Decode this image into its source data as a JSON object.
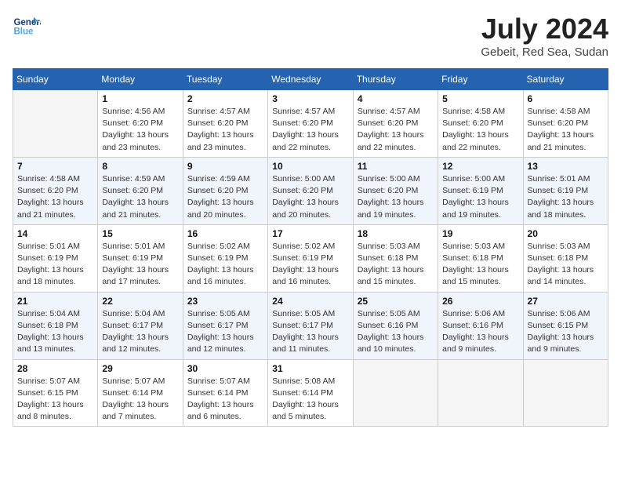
{
  "header": {
    "logo_line1": "General",
    "logo_line2": "Blue",
    "month_year": "July 2024",
    "location": "Gebeit, Red Sea, Sudan"
  },
  "days_of_week": [
    "Sunday",
    "Monday",
    "Tuesday",
    "Wednesday",
    "Thursday",
    "Friday",
    "Saturday"
  ],
  "weeks": [
    [
      {
        "day": null
      },
      {
        "day": 1,
        "sunrise": "4:56 AM",
        "sunset": "6:20 PM",
        "daylight": "13 hours and 23 minutes."
      },
      {
        "day": 2,
        "sunrise": "4:57 AM",
        "sunset": "6:20 PM",
        "daylight": "13 hours and 23 minutes."
      },
      {
        "day": 3,
        "sunrise": "4:57 AM",
        "sunset": "6:20 PM",
        "daylight": "13 hours and 22 minutes."
      },
      {
        "day": 4,
        "sunrise": "4:57 AM",
        "sunset": "6:20 PM",
        "daylight": "13 hours and 22 minutes."
      },
      {
        "day": 5,
        "sunrise": "4:58 AM",
        "sunset": "6:20 PM",
        "daylight": "13 hours and 22 minutes."
      },
      {
        "day": 6,
        "sunrise": "4:58 AM",
        "sunset": "6:20 PM",
        "daylight": "13 hours and 21 minutes."
      }
    ],
    [
      {
        "day": 7,
        "sunrise": "4:58 AM",
        "sunset": "6:20 PM",
        "daylight": "13 hours and 21 minutes."
      },
      {
        "day": 8,
        "sunrise": "4:59 AM",
        "sunset": "6:20 PM",
        "daylight": "13 hours and 21 minutes."
      },
      {
        "day": 9,
        "sunrise": "4:59 AM",
        "sunset": "6:20 PM",
        "daylight": "13 hours and 20 minutes."
      },
      {
        "day": 10,
        "sunrise": "5:00 AM",
        "sunset": "6:20 PM",
        "daylight": "13 hours and 20 minutes."
      },
      {
        "day": 11,
        "sunrise": "5:00 AM",
        "sunset": "6:20 PM",
        "daylight": "13 hours and 19 minutes."
      },
      {
        "day": 12,
        "sunrise": "5:00 AM",
        "sunset": "6:19 PM",
        "daylight": "13 hours and 19 minutes."
      },
      {
        "day": 13,
        "sunrise": "5:01 AM",
        "sunset": "6:19 PM",
        "daylight": "13 hours and 18 minutes."
      }
    ],
    [
      {
        "day": 14,
        "sunrise": "5:01 AM",
        "sunset": "6:19 PM",
        "daylight": "13 hours and 18 minutes."
      },
      {
        "day": 15,
        "sunrise": "5:01 AM",
        "sunset": "6:19 PM",
        "daylight": "13 hours and 17 minutes."
      },
      {
        "day": 16,
        "sunrise": "5:02 AM",
        "sunset": "6:19 PM",
        "daylight": "13 hours and 16 minutes."
      },
      {
        "day": 17,
        "sunrise": "5:02 AM",
        "sunset": "6:19 PM",
        "daylight": "13 hours and 16 minutes."
      },
      {
        "day": 18,
        "sunrise": "5:03 AM",
        "sunset": "6:18 PM",
        "daylight": "13 hours and 15 minutes."
      },
      {
        "day": 19,
        "sunrise": "5:03 AM",
        "sunset": "6:18 PM",
        "daylight": "13 hours and 15 minutes."
      },
      {
        "day": 20,
        "sunrise": "5:03 AM",
        "sunset": "6:18 PM",
        "daylight": "13 hours and 14 minutes."
      }
    ],
    [
      {
        "day": 21,
        "sunrise": "5:04 AM",
        "sunset": "6:18 PM",
        "daylight": "13 hours and 13 minutes."
      },
      {
        "day": 22,
        "sunrise": "5:04 AM",
        "sunset": "6:17 PM",
        "daylight": "13 hours and 12 minutes."
      },
      {
        "day": 23,
        "sunrise": "5:05 AM",
        "sunset": "6:17 PM",
        "daylight": "13 hours and 12 minutes."
      },
      {
        "day": 24,
        "sunrise": "5:05 AM",
        "sunset": "6:17 PM",
        "daylight": "13 hours and 11 minutes."
      },
      {
        "day": 25,
        "sunrise": "5:05 AM",
        "sunset": "6:16 PM",
        "daylight": "13 hours and 10 minutes."
      },
      {
        "day": 26,
        "sunrise": "5:06 AM",
        "sunset": "6:16 PM",
        "daylight": "13 hours and 9 minutes."
      },
      {
        "day": 27,
        "sunrise": "5:06 AM",
        "sunset": "6:15 PM",
        "daylight": "13 hours and 9 minutes."
      }
    ],
    [
      {
        "day": 28,
        "sunrise": "5:07 AM",
        "sunset": "6:15 PM",
        "daylight": "13 hours and 8 minutes."
      },
      {
        "day": 29,
        "sunrise": "5:07 AM",
        "sunset": "6:14 PM",
        "daylight": "13 hours and 7 minutes."
      },
      {
        "day": 30,
        "sunrise": "5:07 AM",
        "sunset": "6:14 PM",
        "daylight": "13 hours and 6 minutes."
      },
      {
        "day": 31,
        "sunrise": "5:08 AM",
        "sunset": "6:14 PM",
        "daylight": "13 hours and 5 minutes."
      },
      {
        "day": null
      },
      {
        "day": null
      },
      {
        "day": null
      }
    ]
  ]
}
